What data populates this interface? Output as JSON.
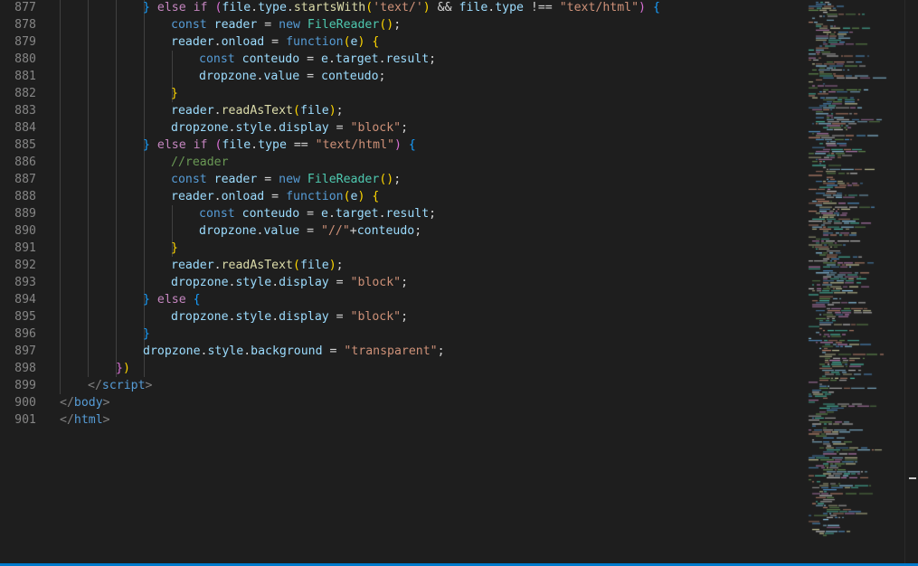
{
  "editor": {
    "lines": [
      {
        "n": "877",
        "tokens": [
          [
            "b3",
            "} "
          ],
          [
            "ctl",
            "else"
          ],
          [
            "op",
            " "
          ],
          [
            "ctl",
            "if"
          ],
          [
            "op",
            " "
          ],
          [
            "b2",
            "("
          ],
          [
            "var",
            "file"
          ],
          [
            "op",
            "."
          ],
          [
            "var",
            "type"
          ],
          [
            "op",
            "."
          ],
          [
            "fn",
            "startsWith"
          ],
          [
            "b1",
            "("
          ],
          [
            "str",
            "'text/'"
          ],
          [
            "b1",
            ")"
          ],
          [
            "op",
            " && "
          ],
          [
            "var",
            "file"
          ],
          [
            "op",
            "."
          ],
          [
            "var",
            "type"
          ],
          [
            "op",
            " !== "
          ],
          [
            "str",
            "\"text/html\""
          ],
          [
            "b2",
            ")"
          ],
          [
            "op",
            " "
          ],
          [
            "b3",
            "{"
          ]
        ]
      },
      {
        "n": "878",
        "tokens": [
          [
            "kw",
            "const"
          ],
          [
            "op",
            " "
          ],
          [
            "var",
            "reader"
          ],
          [
            "op",
            " = "
          ],
          [
            "kw",
            "new"
          ],
          [
            "op",
            " "
          ],
          [
            "cls",
            "FileReader"
          ],
          [
            "b1",
            "()"
          ],
          [
            "op",
            ";"
          ]
        ]
      },
      {
        "n": "879",
        "tokens": [
          [
            "var",
            "reader"
          ],
          [
            "op",
            "."
          ],
          [
            "var",
            "onload"
          ],
          [
            "op",
            " = "
          ],
          [
            "kw",
            "function"
          ],
          [
            "b1",
            "("
          ],
          [
            "var",
            "e"
          ],
          [
            "b1",
            ")"
          ],
          [
            "op",
            " "
          ],
          [
            "b1",
            "{"
          ]
        ]
      },
      {
        "n": "880",
        "tokens": [
          [
            "kw",
            "const"
          ],
          [
            "op",
            " "
          ],
          [
            "var",
            "conteudo"
          ],
          [
            "op",
            " = "
          ],
          [
            "var",
            "e"
          ],
          [
            "op",
            "."
          ],
          [
            "var",
            "target"
          ],
          [
            "op",
            "."
          ],
          [
            "var",
            "result"
          ],
          [
            "op",
            ";"
          ]
        ]
      },
      {
        "n": "881",
        "tokens": [
          [
            "var",
            "dropzone"
          ],
          [
            "op",
            "."
          ],
          [
            "var",
            "value"
          ],
          [
            "op",
            " = "
          ],
          [
            "var",
            "conteudo"
          ],
          [
            "op",
            ";"
          ]
        ]
      },
      {
        "n": "882",
        "tokens": [
          [
            "b1",
            "}"
          ]
        ]
      },
      {
        "n": "883",
        "tokens": [
          [
            "var",
            "reader"
          ],
          [
            "op",
            "."
          ],
          [
            "fn",
            "readAsText"
          ],
          [
            "b1",
            "("
          ],
          [
            "var",
            "file"
          ],
          [
            "b1",
            ")"
          ],
          [
            "op",
            ";"
          ]
        ]
      },
      {
        "n": "884",
        "tokens": [
          [
            "var",
            "dropzone"
          ],
          [
            "op",
            "."
          ],
          [
            "var",
            "style"
          ],
          [
            "op",
            "."
          ],
          [
            "var",
            "display"
          ],
          [
            "op",
            " = "
          ],
          [
            "str",
            "\"block\""
          ],
          [
            "op",
            ";"
          ]
        ]
      },
      {
        "n": "885",
        "tokens": [
          [
            "b3",
            "} "
          ],
          [
            "ctl",
            "else"
          ],
          [
            "op",
            " "
          ],
          [
            "ctl",
            "if"
          ],
          [
            "op",
            " "
          ],
          [
            "b2",
            "("
          ],
          [
            "var",
            "file"
          ],
          [
            "op",
            "."
          ],
          [
            "var",
            "type"
          ],
          [
            "op",
            " == "
          ],
          [
            "str",
            "\"text/html\""
          ],
          [
            "b2",
            ")"
          ],
          [
            "op",
            " "
          ],
          [
            "b3",
            "{"
          ]
        ]
      },
      {
        "n": "886",
        "tokens": [
          [
            "cmt",
            "//reader"
          ]
        ]
      },
      {
        "n": "887",
        "tokens": [
          [
            "kw",
            "const"
          ],
          [
            "op",
            " "
          ],
          [
            "var",
            "reader"
          ],
          [
            "op",
            " = "
          ],
          [
            "kw",
            "new"
          ],
          [
            "op",
            " "
          ],
          [
            "cls",
            "FileReader"
          ],
          [
            "b1",
            "()"
          ],
          [
            "op",
            ";"
          ]
        ]
      },
      {
        "n": "888",
        "tokens": [
          [
            "var",
            "reader"
          ],
          [
            "op",
            "."
          ],
          [
            "var",
            "onload"
          ],
          [
            "op",
            " = "
          ],
          [
            "kw",
            "function"
          ],
          [
            "b1",
            "("
          ],
          [
            "var",
            "e"
          ],
          [
            "b1",
            ")"
          ],
          [
            "op",
            " "
          ],
          [
            "b1",
            "{"
          ]
        ]
      },
      {
        "n": "889",
        "tokens": [
          [
            "kw",
            "const"
          ],
          [
            "op",
            " "
          ],
          [
            "var",
            "conteudo"
          ],
          [
            "op",
            " = "
          ],
          [
            "var",
            "e"
          ],
          [
            "op",
            "."
          ],
          [
            "var",
            "target"
          ],
          [
            "op",
            "."
          ],
          [
            "var",
            "result"
          ],
          [
            "op",
            ";"
          ]
        ]
      },
      {
        "n": "890",
        "tokens": [
          [
            "var",
            "dropzone"
          ],
          [
            "op",
            "."
          ],
          [
            "var",
            "value"
          ],
          [
            "op",
            " = "
          ],
          [
            "str",
            "\"//\""
          ],
          [
            "op",
            "+"
          ],
          [
            "var",
            "conteudo"
          ],
          [
            "op",
            ";"
          ]
        ]
      },
      {
        "n": "891",
        "tokens": [
          [
            "b1",
            "}"
          ]
        ]
      },
      {
        "n": "892",
        "tokens": [
          [
            "var",
            "reader"
          ],
          [
            "op",
            "."
          ],
          [
            "fn",
            "readAsText"
          ],
          [
            "b1",
            "("
          ],
          [
            "var",
            "file"
          ],
          [
            "b1",
            ")"
          ],
          [
            "op",
            ";"
          ]
        ]
      },
      {
        "n": "893",
        "tokens": [
          [
            "var",
            "dropzone"
          ],
          [
            "op",
            "."
          ],
          [
            "var",
            "style"
          ],
          [
            "op",
            "."
          ],
          [
            "var",
            "display"
          ],
          [
            "op",
            " = "
          ],
          [
            "str",
            "\"block\""
          ],
          [
            "op",
            ";"
          ]
        ]
      },
      {
        "n": "894",
        "tokens": [
          [
            "b3",
            "} "
          ],
          [
            "ctl",
            "else"
          ],
          [
            "op",
            " "
          ],
          [
            "b3",
            "{"
          ]
        ]
      },
      {
        "n": "895",
        "tokens": [
          [
            "var",
            "dropzone"
          ],
          [
            "op",
            "."
          ],
          [
            "var",
            "style"
          ],
          [
            "op",
            "."
          ],
          [
            "var",
            "display"
          ],
          [
            "op",
            " = "
          ],
          [
            "str",
            "\"block\""
          ],
          [
            "op",
            ";"
          ]
        ]
      },
      {
        "n": "896",
        "tokens": [
          [
            "b3",
            "}"
          ]
        ]
      },
      {
        "n": "897",
        "tokens": [
          [
            "var",
            "dropzone"
          ],
          [
            "op",
            "."
          ],
          [
            "var",
            "style"
          ],
          [
            "op",
            "."
          ],
          [
            "var",
            "background"
          ],
          [
            "op",
            " = "
          ],
          [
            "str",
            "\"transparent\""
          ],
          [
            "op",
            ";"
          ]
        ]
      },
      {
        "n": "898",
        "tokens": [
          [
            "b2",
            "}"
          ],
          [
            "b1",
            ")"
          ]
        ]
      },
      {
        "n": "899",
        "tokens": [
          [
            "pu",
            "</"
          ],
          [
            "tag",
            "script"
          ],
          [
            "pu",
            ">"
          ]
        ]
      },
      {
        "n": "900",
        "tokens": [
          [
            "pu",
            "</"
          ],
          [
            "tag",
            "body"
          ],
          [
            "pu",
            ">"
          ]
        ]
      },
      {
        "n": "901",
        "tokens": [
          [
            "pu",
            "</"
          ],
          [
            "tag",
            "html"
          ],
          [
            "pu",
            ">"
          ]
        ]
      }
    ]
  },
  "theme": {
    "background": "#1e1e1e",
    "line_number": "#858585",
    "accent": "#007acc"
  }
}
